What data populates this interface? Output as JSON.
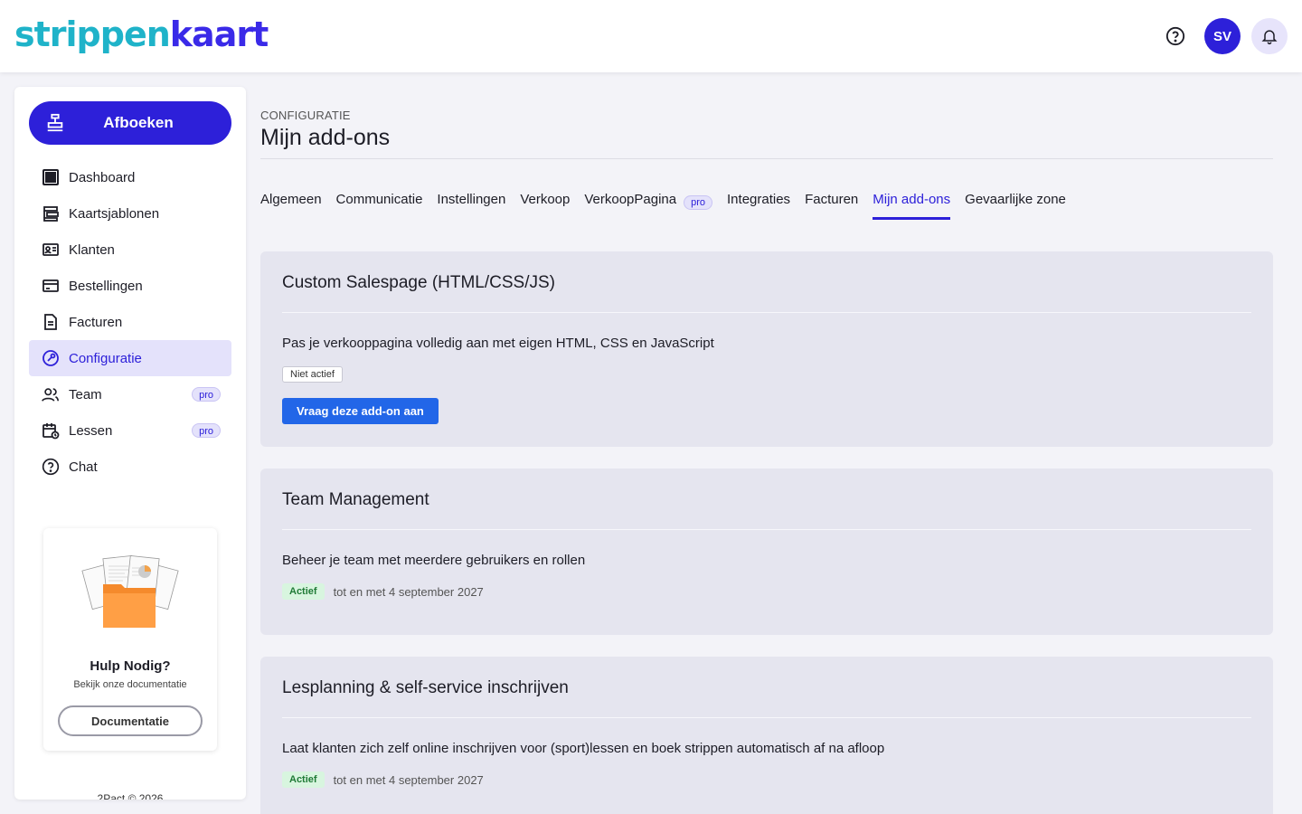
{
  "header": {
    "logo_part1": "strippen",
    "logo_part2": "kaart",
    "avatar_initials": "SV"
  },
  "sidebar": {
    "primary_button": "Afboeken",
    "items": [
      {
        "label": "Dashboard",
        "icon": "dashboard-icon"
      },
      {
        "label": "Kaartsjablonen",
        "icon": "templates-icon"
      },
      {
        "label": "Klanten",
        "icon": "id-card-icon"
      },
      {
        "label": "Bestellingen",
        "icon": "credit-card-icon"
      },
      {
        "label": "Facturen",
        "icon": "document-icon"
      },
      {
        "label": "Configuratie",
        "icon": "wrench-icon",
        "active": true
      },
      {
        "label": "Team",
        "icon": "users-icon",
        "badge": "pro"
      },
      {
        "label": "Lessen",
        "icon": "calendar-clock-icon",
        "badge": "pro"
      },
      {
        "label": "Chat",
        "icon": "question-icon"
      }
    ],
    "help_card": {
      "title": "Hulp Nodig?",
      "subtitle": "Bekijk onze documentatie",
      "button": "Documentatie"
    },
    "copyright": "2Pact © 2026"
  },
  "main": {
    "breadcrumb": "CONFIGURATIE",
    "title": "Mijn add-ons",
    "tabs": [
      {
        "label": "Algemeen"
      },
      {
        "label": "Communicatie"
      },
      {
        "label": "Instellingen"
      },
      {
        "label": "Verkoop"
      },
      {
        "label": "VerkoopPagina",
        "badge": "pro"
      },
      {
        "label": "Integraties"
      },
      {
        "label": "Facturen"
      },
      {
        "label": "Mijn add-ons",
        "active": true
      },
      {
        "label": "Gevaarlijke zone"
      }
    ],
    "addons": [
      {
        "title": "Custom Salespage (HTML/CSS/JS)",
        "description": "Pas je verkooppagina volledig aan met eigen HTML, CSS en JavaScript",
        "status": "Niet actief",
        "button": "Vraag deze add-on aan"
      },
      {
        "title": "Team Management",
        "description": "Beheer je team met meerdere gebruikers en rollen",
        "status": "Actief",
        "until": "tot en met 4 september 2027"
      },
      {
        "title": "Lesplanning & self-service inschrijven",
        "description": "Laat klanten zich zelf online inschrijven voor (sport)lessen en boek strippen automatisch af na afloop",
        "status": "Actief",
        "until": "tot en met 4 september 2027"
      }
    ]
  },
  "colors": {
    "primary": "#2d20d9",
    "accent_teal": "#1fb3c9",
    "button_blue": "#2266e8",
    "active_green": "#1f7a36"
  }
}
